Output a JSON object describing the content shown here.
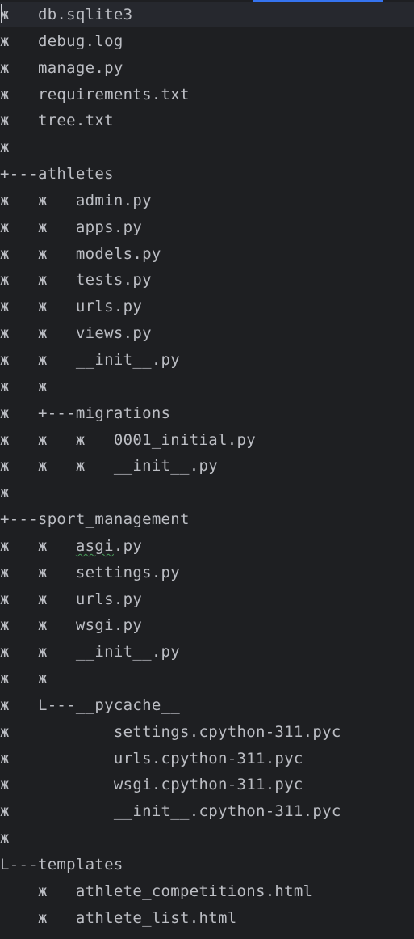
{
  "editor": {
    "lines": [
      "ж   db.sqlite3",
      "ж   debug.log",
      "ж   manage.py",
      "ж   requirements.txt",
      "ж   tree.txt",
      "ж",
      "+---athletes",
      "ж   ж   admin.py",
      "ж   ж   apps.py",
      "ж   ж   models.py",
      "ж   ж   tests.py",
      "ж   ж   urls.py",
      "ж   ж   views.py",
      "ж   ж   __init__.py",
      "ж   ж",
      "ж   +---migrations",
      "ж   ж   ж   0001_initial.py",
      "ж   ж   ж   __init__.py",
      "ж",
      "+---sport_management",
      "ж   ж   asgi.py",
      "ж   ж   settings.py",
      "ж   ж   urls.py",
      "ж   ж   wsgi.py",
      "ж   ж   __init__.py",
      "ж   ж",
      "ж   L---__pycache__",
      "ж           settings.cpython-311.pyc",
      "ж           urls.cpython-311.pyc",
      "ж           wsgi.cpython-311.pyc",
      "ж           __init__.cpython-311.pyc",
      "ж",
      "L---templates",
      "    ж   athlete_competitions.html",
      "    ж   athlete_list.html"
    ],
    "highlight_color": "#26282e",
    "text_color": "#bcbec4",
    "accent_color": "#3574f0"
  }
}
